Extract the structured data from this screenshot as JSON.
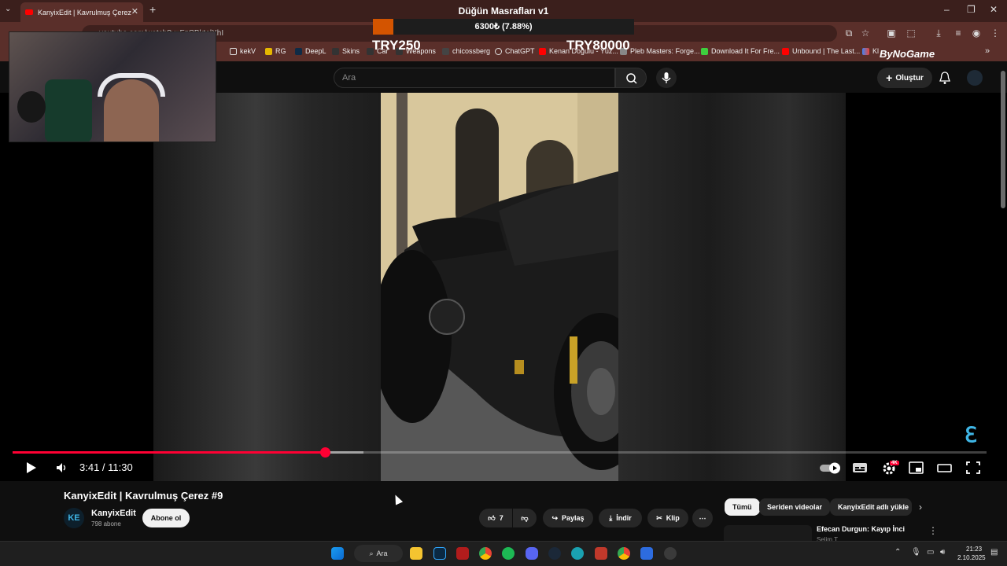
{
  "browser": {
    "tab_title": "KanyixEdit | Kavrulmuş Çerez #9",
    "url": "youtube.com/watch?v=FzCBktolXhI",
    "bookmarks": [
      "kekV",
      "RG",
      "DeepL",
      "Skins",
      "Car",
      "Weapons",
      "chicossberg",
      "ChatGPT",
      "Kenan Doğulu - Yüz...",
      "Pleb Masters: Forge...",
      "Download It For Fre...",
      "Unbound | The Last...",
      "Kl"
    ]
  },
  "overlay": {
    "title": "Düğün Masrafları v1",
    "progress_text": "6300₺ (7.88%)",
    "progress_fraction": 0.0788,
    "min_label": "TRY250",
    "max_label": "TRY80000",
    "brand": "ByNoGame"
  },
  "youtube": {
    "search_placeholder": "Ara",
    "create_label": "Oluştur"
  },
  "player": {
    "current_time": "3:41",
    "duration": "11:30",
    "time_display": "3:41 / 11:30",
    "played_fraction": 0.3204,
    "buffered_fraction": 0.36,
    "quality_badge": "4K"
  },
  "video_info": {
    "title": "KanyixEdit | Kavrulmuş Çerez #9",
    "channel": "KanyixEdit",
    "channel_avatar_text": "KE",
    "subscribers": "798 abone",
    "subscribe_label": "Abone ol",
    "likes": "7",
    "share_label": "Paylaş",
    "download_label": "İndir",
    "clip_label": "Klip"
  },
  "chips": [
    "Tümü",
    "Seriden videolar",
    "KanyixEdit adlı yükle"
  ],
  "recommendation": {
    "title": "Efecan Durgun: Kayıp İnci",
    "subtitle": "Selim T."
  },
  "taskbar": {
    "search_label": "Ara",
    "time": "21:23",
    "date": "2.10.2025"
  },
  "colors": {
    "accent_red": "#ff0033",
    "overlay_orange": "#d35400",
    "browser_maroon": "#5a2f2a",
    "channel_blue": "#3fb6e6"
  }
}
